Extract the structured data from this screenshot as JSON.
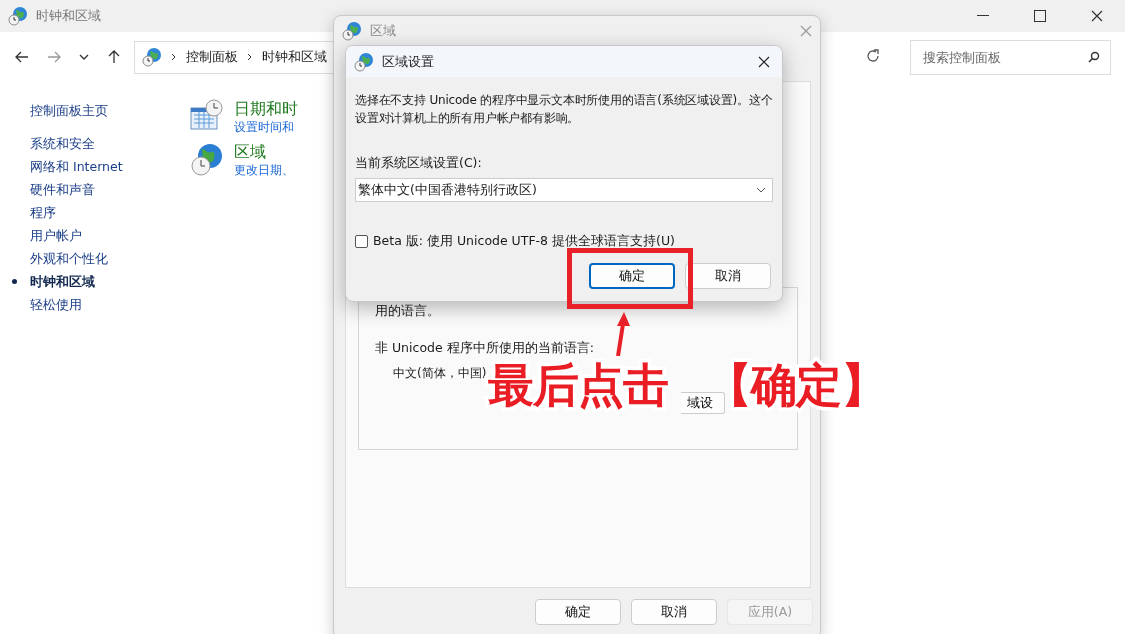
{
  "main_window": {
    "title": "时钟和区域",
    "breadcrumb": [
      "控制面板",
      "时钟和区域"
    ],
    "search": {
      "placeholder": "搜索控制面板"
    },
    "sidebar": {
      "items": [
        {
          "label": "控制面板主页",
          "selected": false
        },
        {
          "label": "系统和安全",
          "selected": false
        },
        {
          "label": "网络和 Internet",
          "selected": false
        },
        {
          "label": "硬件和声音",
          "selected": false
        },
        {
          "label": "程序",
          "selected": false
        },
        {
          "label": "用户帐户",
          "selected": false
        },
        {
          "label": "外观和个性化",
          "selected": false
        },
        {
          "label": "时钟和区域",
          "selected": true
        },
        {
          "label": "轻松使用",
          "selected": false
        }
      ]
    },
    "categories": [
      {
        "kind": "calendar",
        "title": "日期和时",
        "link": "设置时间和"
      },
      {
        "kind": "globe",
        "title": "区域",
        "link": "更改日期、"
      }
    ]
  },
  "region_dialog": {
    "title": "区域",
    "group_lines": [
      "用的语言。",
      "非 Unicode 程序中所使用的当前语言:"
    ],
    "current_language": "中文(简体，中国)",
    "change_button": "域设",
    "buttons": [
      {
        "label": "确定",
        "disabled": false
      },
      {
        "label": "取消",
        "disabled": false
      },
      {
        "label": "应用(A)",
        "disabled": true
      }
    ]
  },
  "locale_dialog": {
    "title": "区域设置",
    "description": "选择在不支持 Unicode 的程序中显示文本时所使用的语言(系统区域设置)。这个设置对计算机上的所有用户帐户都有影响。",
    "locale_label": "当前系统区域设置(C):",
    "locale_value": "繁体中文(中国香港特别行政区)",
    "beta_option": {
      "label": "Beta 版: 使用 Unicode UTF-8 提供全球语言支持(U)",
      "checked": false
    },
    "buttons": [
      {
        "label": "确定",
        "focused": true
      },
      {
        "label": "取消",
        "focused": false
      }
    ]
  },
  "annotation": {
    "texts": [
      "最后点击",
      "【确定】"
    ]
  }
}
